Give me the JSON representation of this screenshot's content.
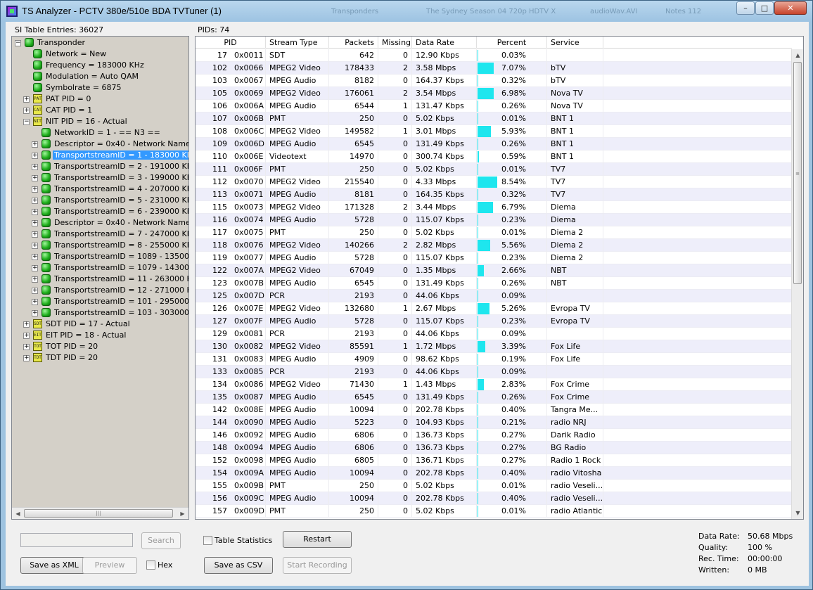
{
  "window": {
    "title": "TS Analyzer - PCTV 380e/510e BDA TVTuner (1)",
    "ghost_titles": [
      "Transponders",
      "The Sydney Season 04 720p HDTV X",
      "audioWav.AVI",
      "Notes 112"
    ],
    "controls": {
      "minimize": "–",
      "maximize": "□",
      "close": "✕"
    }
  },
  "left": {
    "caption": "SI Table Entries: 36027",
    "tree": [
      {
        "level": 0,
        "icon": "green",
        "label": "Transponder",
        "expander": "−"
      },
      {
        "level": 1,
        "icon": "green",
        "label": "Network = New"
      },
      {
        "level": 1,
        "icon": "green",
        "label": "Frequency = 183000 KHz"
      },
      {
        "level": 1,
        "icon": "green",
        "label": "Modulation = Auto QAM"
      },
      {
        "level": 1,
        "icon": "green",
        "label": "Symbolrate = 6875"
      },
      {
        "level": 1,
        "icon": "tag",
        "tag": "PAT",
        "label": "PAT PID = 0",
        "expander": "+"
      },
      {
        "level": 1,
        "icon": "tag",
        "tag": "CAT",
        "label": "CAT PID = 1",
        "expander": "+"
      },
      {
        "level": 1,
        "icon": "tag",
        "tag": "NIT",
        "label": "NIT PID = 16 - Actual",
        "expander": "−"
      },
      {
        "level": 2,
        "icon": "green",
        "label": "NetworkID = 1 - == N3 =="
      },
      {
        "level": 2,
        "icon": "green",
        "label": "Descriptor = 0x40 - Network Name",
        "expander": "+"
      },
      {
        "level": 2,
        "icon": "green",
        "label": "TransportstreamID = 1 - 183000 KHz",
        "expander": "+",
        "selected": true
      },
      {
        "level": 2,
        "icon": "green",
        "label": "TransportstreamID = 2 - 191000 KHz",
        "expander": "+"
      },
      {
        "level": 2,
        "icon": "green",
        "label": "TransportstreamID = 3 - 199000 KHz",
        "expander": "+"
      },
      {
        "level": 2,
        "icon": "green",
        "label": "TransportstreamID = 4 - 207000 KHz",
        "expander": "+"
      },
      {
        "level": 2,
        "icon": "green",
        "label": "TransportstreamID = 5 - 231000 KHz",
        "expander": "+"
      },
      {
        "level": 2,
        "icon": "green",
        "label": "TransportstreamID = 6 - 239000 KHz",
        "expander": "+"
      },
      {
        "level": 2,
        "icon": "green",
        "label": "Descriptor = 0x40 - Network Name",
        "expander": "+"
      },
      {
        "level": 2,
        "icon": "green",
        "label": "TransportstreamID = 7 - 247000 KHz",
        "expander": "+"
      },
      {
        "level": 2,
        "icon": "green",
        "label": "TransportstreamID = 8 - 255000 KHz",
        "expander": "+"
      },
      {
        "level": 2,
        "icon": "green",
        "label": "TransportstreamID = 1089 - 135000 KHz",
        "expander": "+"
      },
      {
        "level": 2,
        "icon": "green",
        "label": "TransportstreamID = 1079 - 143000 KHz",
        "expander": "+"
      },
      {
        "level": 2,
        "icon": "green",
        "label": "TransportstreamID = 11 - 263000 KHz",
        "expander": "+"
      },
      {
        "level": 2,
        "icon": "green",
        "label": "TransportstreamID = 12 - 271000 KHz",
        "expander": "+"
      },
      {
        "level": 2,
        "icon": "green",
        "label": "TransportstreamID = 101 - 295000 KHz",
        "expander": "+"
      },
      {
        "level": 2,
        "icon": "green",
        "label": "TransportstreamID = 103 - 303000 KHz",
        "expander": "+"
      },
      {
        "level": 1,
        "icon": "tag",
        "tag": "SDT",
        "label": "SDT PID = 17 - Actual",
        "expander": "+"
      },
      {
        "level": 1,
        "icon": "tag",
        "tag": "EIT",
        "label": "EIT PID = 18 - Actual",
        "expander": "+"
      },
      {
        "level": 1,
        "icon": "tag",
        "tag": "TOT",
        "label": "TOT PID = 20",
        "expander": "+"
      },
      {
        "level": 1,
        "icon": "tag",
        "tag": "TDT",
        "label": "TDT PID = 20",
        "expander": "+"
      }
    ],
    "search_placeholder": "",
    "search_button": "Search",
    "save_xml_button": "Save as XML",
    "preview_button": "Preview",
    "hex_label": "Hex"
  },
  "main": {
    "caption": "PIDs: 74",
    "columns": [
      "PID",
      "Stream Type",
      "Packets",
      "Missing",
      "Data Rate",
      "Percent",
      "Service"
    ],
    "rows": [
      [
        "17",
        "0x0011",
        "SDT",
        "642",
        "0",
        "12.90 Kbps",
        "0.03%",
        0.03,
        ""
      ],
      [
        "102",
        "0x0066",
        "MPEG2 Video",
        "178433",
        "2",
        "3.58 Mbps",
        "7.07%",
        7.07,
        "bTV"
      ],
      [
        "103",
        "0x0067",
        "MPEG Audio",
        "8182",
        "0",
        "164.37 Kbps",
        "0.32%",
        0.32,
        "bTV"
      ],
      [
        "105",
        "0x0069",
        "MPEG2 Video",
        "176061",
        "2",
        "3.54 Mbps",
        "6.98%",
        6.98,
        "Nova TV"
      ],
      [
        "106",
        "0x006A",
        "MPEG Audio",
        "6544",
        "1",
        "131.47 Kbps",
        "0.26%",
        0.26,
        "Nova TV"
      ],
      [
        "107",
        "0x006B",
        "PMT",
        "250",
        "0",
        "5.02 Kbps",
        "0.01%",
        0.01,
        "BNT 1"
      ],
      [
        "108",
        "0x006C",
        "MPEG2 Video",
        "149582",
        "1",
        "3.01 Mbps",
        "5.93%",
        5.93,
        "BNT 1"
      ],
      [
        "109",
        "0x006D",
        "MPEG Audio",
        "6545",
        "0",
        "131.49 Kbps",
        "0.26%",
        0.26,
        "BNT 1"
      ],
      [
        "110",
        "0x006E",
        "Videotext",
        "14970",
        "0",
        "300.74 Kbps",
        "0.59%",
        0.59,
        "BNT 1"
      ],
      [
        "111",
        "0x006F",
        "PMT",
        "250",
        "0",
        "5.02 Kbps",
        "0.01%",
        0.01,
        "TV7"
      ],
      [
        "112",
        "0x0070",
        "MPEG2 Video",
        "215540",
        "0",
        "4.33 Mbps",
        "8.54%",
        8.54,
        "TV7"
      ],
      [
        "113",
        "0x0071",
        "MPEG Audio",
        "8181",
        "0",
        "164.35 Kbps",
        "0.32%",
        0.32,
        "TV7"
      ],
      [
        "115",
        "0x0073",
        "MPEG2 Video",
        "171328",
        "2",
        "3.44 Mbps",
        "6.79%",
        6.79,
        "Diema"
      ],
      [
        "116",
        "0x0074",
        "MPEG Audio",
        "5728",
        "0",
        "115.07 Kbps",
        "0.23%",
        0.23,
        "Diema"
      ],
      [
        "117",
        "0x0075",
        "PMT",
        "250",
        "0",
        "5.02 Kbps",
        "0.01%",
        0.01,
        "Diema 2"
      ],
      [
        "118",
        "0x0076",
        "MPEG2 Video",
        "140266",
        "2",
        "2.82 Mbps",
        "5.56%",
        5.56,
        "Diema 2"
      ],
      [
        "119",
        "0x0077",
        "MPEG Audio",
        "5728",
        "0",
        "115.07 Kbps",
        "0.23%",
        0.23,
        "Diema 2"
      ],
      [
        "122",
        "0x007A",
        "MPEG2 Video",
        "67049",
        "0",
        "1.35 Mbps",
        "2.66%",
        2.66,
        "NBT"
      ],
      [
        "123",
        "0x007B",
        "MPEG Audio",
        "6545",
        "0",
        "131.49 Kbps",
        "0.26%",
        0.26,
        "NBT"
      ],
      [
        "125",
        "0x007D",
        "PCR",
        "2193",
        "0",
        "44.06 Kbps",
        "0.09%",
        0.09,
        ""
      ],
      [
        "126",
        "0x007E",
        "MPEG2 Video",
        "132680",
        "1",
        "2.67 Mbps",
        "5.26%",
        5.26,
        "Evropa TV"
      ],
      [
        "127",
        "0x007F",
        "MPEG Audio",
        "5728",
        "0",
        "115.07 Kbps",
        "0.23%",
        0.23,
        "Evropa TV"
      ],
      [
        "129",
        "0x0081",
        "PCR",
        "2193",
        "0",
        "44.06 Kbps",
        "0.09%",
        0.09,
        ""
      ],
      [
        "130",
        "0x0082",
        "MPEG2 Video",
        "85591",
        "1",
        "1.72 Mbps",
        "3.39%",
        3.39,
        "Fox Life"
      ],
      [
        "131",
        "0x0083",
        "MPEG Audio",
        "4909",
        "0",
        "98.62 Kbps",
        "0.19%",
        0.19,
        "Fox Life"
      ],
      [
        "133",
        "0x0085",
        "PCR",
        "2193",
        "0",
        "44.06 Kbps",
        "0.09%",
        0.09,
        ""
      ],
      [
        "134",
        "0x0086",
        "MPEG2 Video",
        "71430",
        "1",
        "1.43 Mbps",
        "2.83%",
        2.83,
        "Fox Crime"
      ],
      [
        "135",
        "0x0087",
        "MPEG Audio",
        "6545",
        "0",
        "131.49 Kbps",
        "0.26%",
        0.26,
        "Fox Crime"
      ],
      [
        "142",
        "0x008E",
        "MPEG Audio",
        "10094",
        "0",
        "202.78 Kbps",
        "0.40%",
        0.4,
        "Tangra Me..."
      ],
      [
        "144",
        "0x0090",
        "MPEG Audio",
        "5223",
        "0",
        "104.93 Kbps",
        "0.21%",
        0.21,
        "radio NRJ"
      ],
      [
        "146",
        "0x0092",
        "MPEG Audio",
        "6806",
        "0",
        "136.73 Kbps",
        "0.27%",
        0.27,
        "Darik Radio"
      ],
      [
        "148",
        "0x0094",
        "MPEG Audio",
        "6806",
        "0",
        "136.73 Kbps",
        "0.27%",
        0.27,
        "BG Radio"
      ],
      [
        "152",
        "0x0098",
        "MPEG Audio",
        "6805",
        "0",
        "136.71 Kbps",
        "0.27%",
        0.27,
        "Radio 1 Rock"
      ],
      [
        "154",
        "0x009A",
        "MPEG Audio",
        "10094",
        "0",
        "202.78 Kbps",
        "0.40%",
        0.4,
        "radio Vitosha"
      ],
      [
        "155",
        "0x009B",
        "PMT",
        "250",
        "0",
        "5.02 Kbps",
        "0.01%",
        0.01,
        "radio Veseli..."
      ],
      [
        "156",
        "0x009C",
        "MPEG Audio",
        "10094",
        "0",
        "202.78 Kbps",
        "0.40%",
        0.4,
        "radio Veseli..."
      ],
      [
        "157",
        "0x009D",
        "PMT",
        "250",
        "0",
        "5.02 Kbps",
        "0.01%",
        0.01,
        "radio Atlantic"
      ]
    ],
    "bar_color": "#1ee6ee",
    "table_statistics_label": "Table Statistics",
    "restart_button": "Restart",
    "save_csv_button": "Save as CSV",
    "start_recording_button": "Start Recording",
    "stats": [
      {
        "label": "Data Rate:",
        "value": "50.68 Mbps"
      },
      {
        "label": "Quality:",
        "value": "100 %"
      },
      {
        "label": "Rec. Time:",
        "value": "00:00:00"
      },
      {
        "label": "Written:",
        "value": "0 MB"
      }
    ]
  },
  "colors": {
    "selection": "#3399ff",
    "alt_row": "#eeeefa",
    "node_green": "#1fae1c"
  }
}
